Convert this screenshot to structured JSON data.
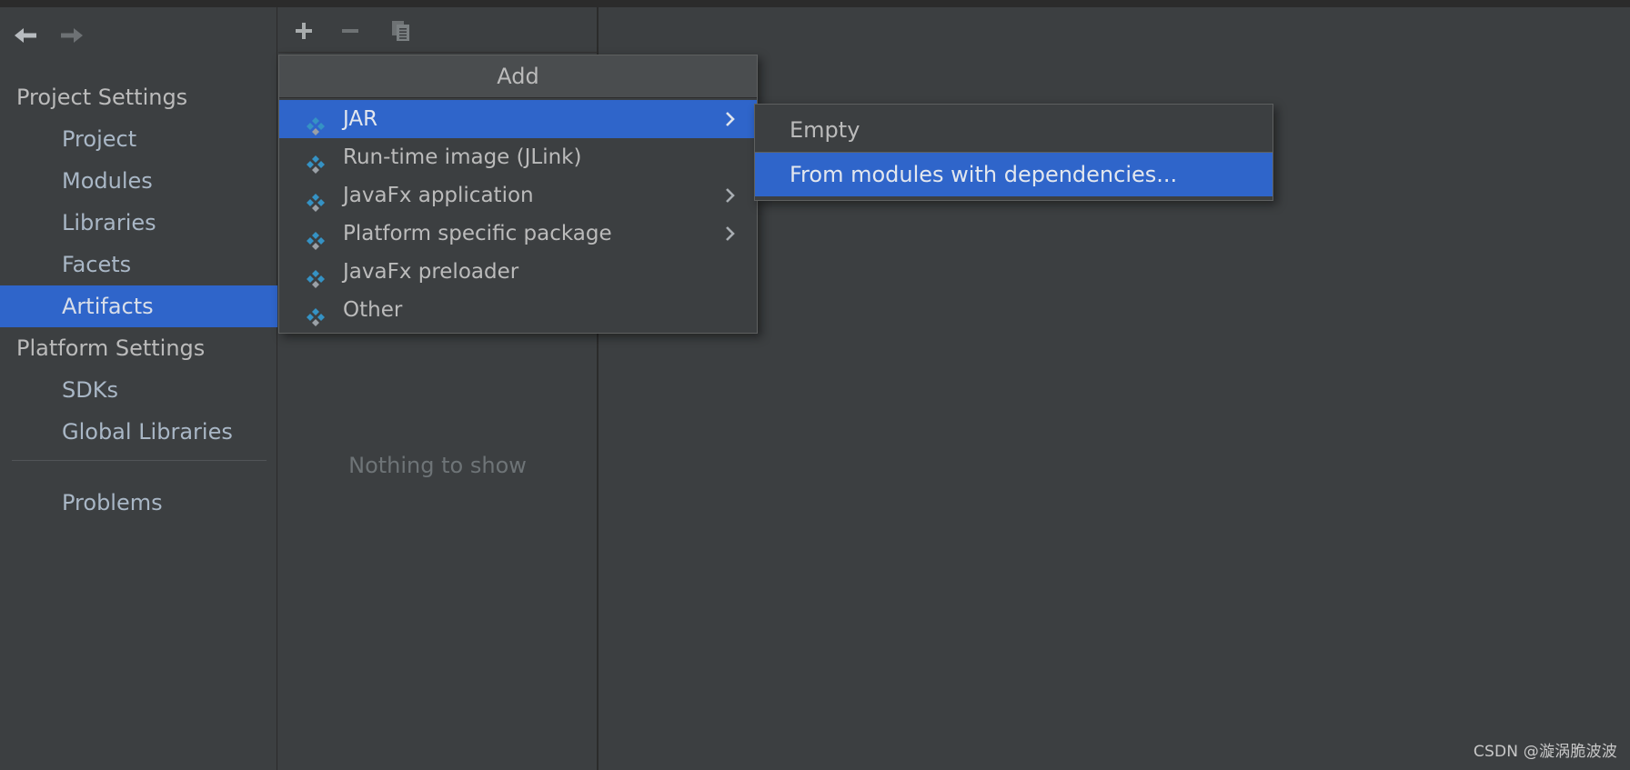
{
  "colors": {
    "background": "#3c3f41",
    "panel_border": "#2b2b2b",
    "accent_selection": "#2f65ca",
    "text_primary": "#bbbbbb",
    "text_tree": "#a9b7c6",
    "text_muted": "#6e7477",
    "icon_blue": "#3592c4",
    "icon_grey": "#9aa0a6"
  },
  "nav": {
    "back_icon": "arrow-left-icon",
    "forward_icon": "arrow-right-icon"
  },
  "sidebar": {
    "items": [
      {
        "label": "Project Settings",
        "type": "group",
        "selected": false
      },
      {
        "label": "Project",
        "type": "leaf",
        "selected": false
      },
      {
        "label": "Modules",
        "type": "leaf",
        "selected": false
      },
      {
        "label": "Libraries",
        "type": "leaf",
        "selected": false
      },
      {
        "label": "Facets",
        "type": "leaf",
        "selected": false
      },
      {
        "label": "Artifacts",
        "type": "leaf",
        "selected": true
      },
      {
        "label": "Platform Settings",
        "type": "group",
        "selected": false
      },
      {
        "label": "SDKs",
        "type": "leaf",
        "selected": false
      },
      {
        "label": "Global Libraries",
        "type": "leaf",
        "selected": false
      }
    ],
    "problems_label": "Problems"
  },
  "toolbar": {
    "add_icon": "plus-icon",
    "remove_icon": "minus-icon",
    "copy_icon": "copy-icon"
  },
  "content": {
    "empty_label": "Nothing to show"
  },
  "popup": {
    "title": "Add",
    "items": [
      {
        "label": "JAR",
        "icon": "artifact-icon",
        "has_submenu": true,
        "highlighted": true
      },
      {
        "label": "Run-time image (JLink)",
        "icon": "artifact-icon",
        "has_submenu": false,
        "highlighted": false
      },
      {
        "label": "JavaFx application",
        "icon": "artifact-icon",
        "has_submenu": true,
        "highlighted": false
      },
      {
        "label": "Platform specific package",
        "icon": "artifact-icon",
        "has_submenu": true,
        "highlighted": false
      },
      {
        "label": "JavaFx preloader",
        "icon": "artifact-icon",
        "has_submenu": false,
        "highlighted": false
      },
      {
        "label": "Other",
        "icon": "artifact-icon",
        "has_submenu": false,
        "highlighted": false
      }
    ]
  },
  "submenu": {
    "items": [
      {
        "label": "Empty",
        "highlighted": false
      },
      {
        "label": "From modules with dependencies...",
        "highlighted": true
      }
    ]
  },
  "watermark": {
    "text": "CSDN @漩涡脆波波"
  }
}
